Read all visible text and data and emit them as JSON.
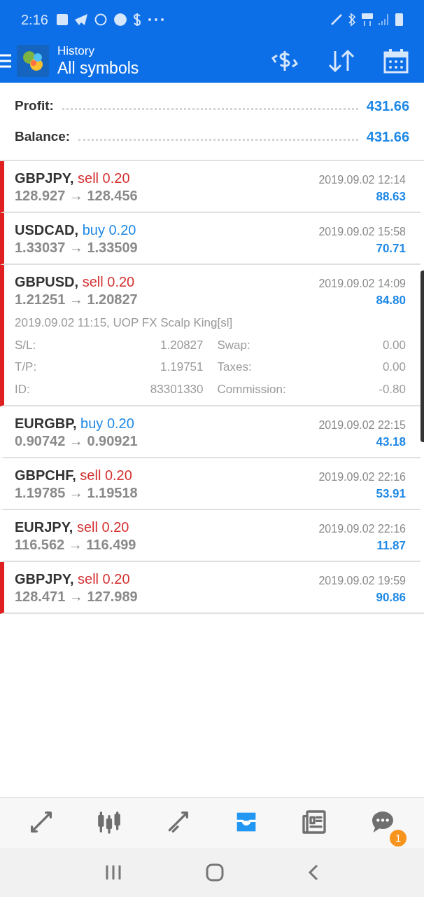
{
  "status_bar": {
    "time": "2:16"
  },
  "app_bar": {
    "subtitle": "History",
    "title": "All symbols"
  },
  "summary": [
    {
      "label": "Profit:",
      "value": "431.66"
    },
    {
      "label": "Balance:",
      "value": "431.66"
    }
  ],
  "deals": [
    {
      "symbol": "GBPJPY,",
      "order": {
        "kind": "sell",
        "text": "sell 0.20"
      },
      "prices": "128.927 → 128.456",
      "time": "2019.09.02 12:14",
      "profit": "88.63",
      "flagged": true,
      "expanded": false
    },
    {
      "symbol": "USDCAD,",
      "order": {
        "kind": "buy",
        "text": "buy 0.20"
      },
      "prices": "1.33037 → 1.33509",
      "time": "2019.09.02 15:58",
      "profit": "70.71",
      "flagged": true,
      "expanded": false
    },
    {
      "symbol": "GBPUSD,",
      "order": {
        "kind": "sell",
        "text": "sell 0.20"
      },
      "prices": "1.21251 → 1.20827",
      "time": "2019.09.02 14:09",
      "profit": "84.80",
      "flagged": true,
      "expanded": true,
      "comment": "2019.09.02 11:15, UOP FX Scalp King[sl]",
      "details": [
        {
          "label": "S/L:",
          "value": "1.20827",
          "label_2": "Swap:",
          "value_2": "0.00"
        },
        {
          "label": "T/P:",
          "value": "1.19751",
          "label_2": "Taxes:",
          "value_2": "0.00"
        },
        {
          "label": "ID:",
          "value": "83301330",
          "label_2": "Commission:",
          "value_2": "-0.80"
        }
      ]
    },
    {
      "symbol": "EURGBP,",
      "order": {
        "kind": "buy",
        "text": "buy 0.20"
      },
      "prices": "0.90742 → 0.90921",
      "time": "2019.09.02 22:15",
      "profit": "43.18",
      "flagged": false,
      "expanded": false
    },
    {
      "symbol": "GBPCHF,",
      "order": {
        "kind": "sell",
        "text": "sell 0.20"
      },
      "prices": "1.19785 → 1.19518",
      "time": "2019.09.02 22:16",
      "profit": "53.91",
      "flagged": false,
      "expanded": false
    },
    {
      "symbol": "EURJPY,",
      "order": {
        "kind": "sell",
        "text": "sell 0.20"
      },
      "prices": "116.562 → 116.499",
      "time": "2019.09.02 22:16",
      "profit": "11.87",
      "flagged": false,
      "expanded": false
    },
    {
      "symbol": "GBPJPY,",
      "order": {
        "kind": "sell",
        "text": "sell 0.20"
      },
      "prices": "128.471 → 127.989",
      "time": "2019.09.02 19:59",
      "profit": "90.86",
      "flagged": true,
      "expanded": false
    }
  ],
  "bottom_nav": [
    {
      "kind": "quotes",
      "selected": false
    },
    {
      "kind": "chart",
      "selected": false
    },
    {
      "kind": "trade",
      "selected": false
    },
    {
      "kind": "history",
      "selected": true
    },
    {
      "kind": "news",
      "selected": false
    },
    {
      "kind": "chat",
      "selected": false,
      "badge": "1"
    }
  ]
}
